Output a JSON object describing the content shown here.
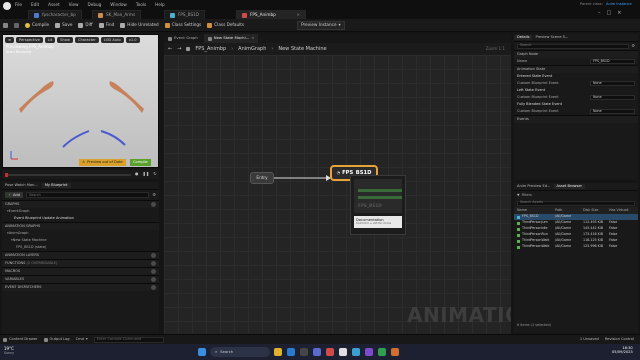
{
  "titlebar": {
    "menu": [
      "File",
      "Edit",
      "Window",
      "Tools",
      "Help"
    ],
    "menu_full": [
      "File",
      "Edit",
      "Asset",
      "View",
      "Debug",
      "Window",
      "Tools",
      "Help"
    ],
    "tabs": [
      "fpscharacter_bp",
      "SK_Man_Arms",
      "FPS_BS1D",
      "FPS_Animbp"
    ],
    "right_label_1": "Parent class:",
    "right_label_2": "Anim Instance"
  },
  "toolbar": {
    "compile": "Compile",
    "save": "Save",
    "diff": "Diff",
    "find": "Find",
    "hide_unrelated": "Hide Unrelated",
    "class_settings": "Class Settings",
    "class_defaults": "Class Defaults",
    "preview_instance": "Preview Instance"
  },
  "viewport": {
    "chips": [
      "Perspective",
      "Lit",
      "Show",
      "Character",
      "LOD Auto",
      "x1.0"
    ],
    "overlay_title": "Previewing FPS_Animbp",
    "overlay_sub": "Anim Blueprint",
    "status_warning": "Preview out of Date",
    "compile_button": "Compile"
  },
  "left_panel": {
    "tabs": [
      "Pose Watch Man...",
      "My Blueprint"
    ],
    "add_label": "Add",
    "search_placeholder": "Search",
    "sections": {
      "graphs": "GRAPHS",
      "event_graph": "EventGraph",
      "event_item": "Event Blueprint Update Animation",
      "animation_graphs": "ANIMATION GRAPHS",
      "anim_graph": "AnimGraph",
      "state_machine": "New State Machine",
      "state": "FPS_BS1D (state)",
      "animation_layers": "ANIMATION LAYERS",
      "functions": "FUNCTIONS",
      "functions_count": "(2 OVERRIDABLE)",
      "macros": "MACROS",
      "variables": "VARIABLES",
      "event_dispatchers": "EVENT DISPATCHERS"
    }
  },
  "graph": {
    "tabs": [
      "Event Graph",
      "New State Machi..."
    ],
    "breadcrumb": [
      "FPS_Animbp",
      "AnimGraph",
      "New State Machine"
    ],
    "zoom": "Zoom 1:1",
    "entry_label": "Entry",
    "state_node_label": "FPS_BS1D",
    "tooltip_title": "Documentation",
    "tooltip_hint": "hold Ctrl + Alt for more",
    "watermark": "ANIMATION"
  },
  "details": {
    "tabs": [
      "Details",
      "Preview Scene S..."
    ],
    "search_placeholder": "Search",
    "graph_node": "Graph Node",
    "name_label": "Name",
    "name_value": "FPS_BS1D",
    "animation_state": "Animation State",
    "entered_state_event": "Entered State Event",
    "custom_bp_event": "Custom Blueprint Event",
    "none": "None",
    "left_state_event": "Left State Event",
    "fully_blended": "Fully Blended State Event",
    "events": "Events"
  },
  "asset_browser": {
    "tabs": [
      "Anim Preview Ed...",
      "Asset Browser"
    ],
    "filters_label": "Filters",
    "search_placeholder": "Search Assets",
    "columns": [
      "Name",
      "Path",
      "Disk Size",
      "Has Virtuali"
    ],
    "rows": [
      {
        "name": "FPS_BS1D",
        "path": "/All/Game",
        "size": "",
        "virt": ""
      },
      {
        "name": "ThirdPersonJum",
        "path": "/All/Game",
        "size": "112.493 KiB",
        "virt": "False"
      },
      {
        "name": "ThirdPersonIdle",
        "path": "/All/Game",
        "size": "145.442 KiB",
        "virt": "False"
      },
      {
        "name": "ThirdPersonRun",
        "path": "/All/Game",
        "size": "175.416 KiB",
        "virt": "False"
      },
      {
        "name": "ThirdPersonWalk",
        "path": "/All/Game",
        "size": "116.125 KiB",
        "virt": "False"
      },
      {
        "name": "ThirdPersonWalk",
        "path": "/All/Game",
        "size": "125.996 KiB",
        "virt": "False"
      }
    ],
    "status": "6 items (1 selected)"
  },
  "statusbar": {
    "content_drawer": "Content Drawer",
    "output_log": "Output Log",
    "cmd": "Cmd",
    "console_placeholder": "Enter Console Command",
    "unsaved": "1 Unsaved",
    "revision": "Revision Control"
  },
  "taskbar": {
    "weather_temp": "19°C",
    "weather_desc": "Sunny",
    "search": "Search",
    "time": "18:30",
    "date": "05/09/2023"
  }
}
